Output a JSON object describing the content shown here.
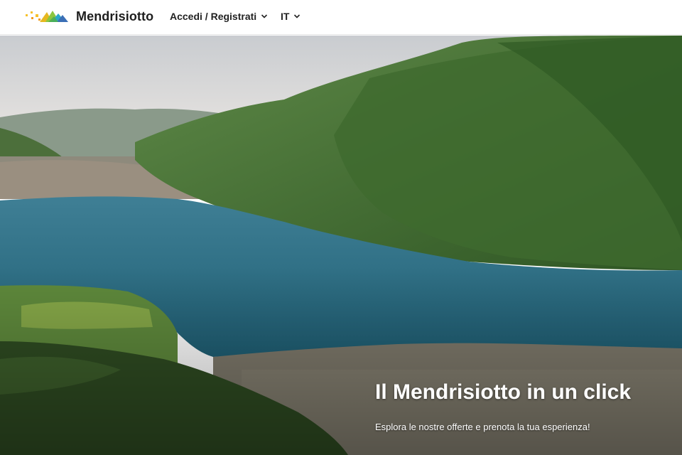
{
  "header": {
    "brand": "Mendrisiotto",
    "nav": {
      "auth_label": "Accedi / Registrati",
      "lang_label": "IT"
    },
    "icons": {
      "logo": "mendrisiotto-logo-icon",
      "auth_dropdown": "chevron-down-icon",
      "lang_dropdown": "chevron-down-icon"
    }
  },
  "hero": {
    "title": "Il Mendrisiotto in un click",
    "subtitle": "Esplora le nostre offerte e prenota la tua esperienza!",
    "image": "lake-valley-photo"
  },
  "colors": {
    "header_bg": "#ffffff",
    "text": "#1e1e1e",
    "hero_text": "#ffffff",
    "lake": "#2b6f86",
    "mountains": "#3e6a2e"
  }
}
